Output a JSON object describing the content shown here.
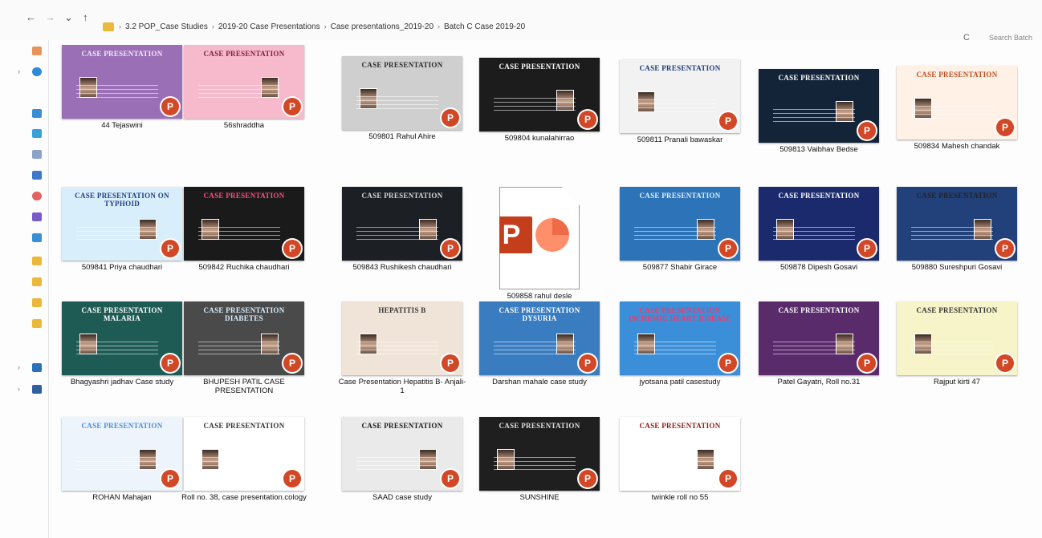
{
  "nav": {
    "back": "←",
    "forward": "→",
    "recent": "⌄",
    "up": "↑"
  },
  "breadcrumb": [
    "3.2 POP_Case Studies",
    "2019-20 Case Presentations",
    "Case presentations_2019-20",
    "Batch C Case 2019-20"
  ],
  "search_placeholder": "Search Batch",
  "refresh_glyph": "C",
  "files": [
    {
      "label": "44 Tejaswini",
      "title": "CASE PRESENTATION",
      "bg": "#9b6fb6",
      "fg": "#f4e9ff"
    },
    {
      "label": "56shraddha",
      "title": "CASE PRESENTATION",
      "bg": "#f7b9cc",
      "fg": "#7a1f3a"
    },
    {
      "label": "509801 Rahul Ahire",
      "title": "CASE PRESENTATION",
      "bg": "#cfcfcf",
      "fg": "#2b2b2b"
    },
    {
      "label": "509804 kunalahirrao",
      "title": "CASE PRESENTATION",
      "bg": "#1c1c1c",
      "fg": "#ffffff"
    },
    {
      "label": "509811 Pranali bawaskar",
      "title": "CASE PRESENTATION",
      "bg": "#f2f2f2",
      "fg": "#1b3b7a"
    },
    {
      "label": "509813 Vaibhav Bedse",
      "title": "CASE PRESENTATION",
      "bg": "#142438",
      "fg": "#ffffff"
    },
    {
      "label": "509834 Mahesh chandak",
      "title": "CASE PRESENTATION",
      "bg": "#fff1e6",
      "fg": "#c14a1f"
    },
    {
      "label": "509841 Priya chaudhari",
      "title": "Case presentation on Typhoid",
      "bg": "#d9eefb",
      "fg": "#1e3f82"
    },
    {
      "label": "509842 Ruchika chaudhari",
      "title": "CASE PRESENTATION",
      "bg": "#1a1a1a",
      "fg": "#ff4f7b"
    },
    {
      "label": "509843 Rushikesh chaudhari",
      "title": "Case presentation",
      "bg": "#1c1f24",
      "fg": "#d8d8d8"
    },
    {
      "label": "509858 rahul desle",
      "title": "",
      "bg": "#ffffff",
      "fg": "#000000"
    },
    {
      "label": "509877 Shabir Girace",
      "title": "CASE PRESENTATION",
      "bg": "#2d73b8",
      "fg": "#e3f1ff"
    },
    {
      "label": "509878 Dipesh Gosavi",
      "title": "CASE PRESENTATION",
      "bg": "#1a2a6c",
      "fg": "#ffffff"
    },
    {
      "label": "509880 Sureshpuri Gosavi",
      "title": "Case Presentation",
      "bg": "#22407a",
      "fg": "#222222"
    },
    {
      "label": "Bhagyashri jadhav Case study",
      "title": "Case Presentation MALARIA",
      "bg": "#1f5b55",
      "fg": "#ffffff"
    },
    {
      "label": "BHUPESH PATIL CASE PRESENTATION",
      "title": "CASE PRESENTATION DIABETES",
      "bg": "#4a4a4a",
      "fg": "#d9f0ff"
    },
    {
      "label": "Case Presentation Hepatitis B- Anjali-1",
      "title": "HEPATITIS B",
      "bg": "#f0e4d8",
      "fg": "#333333"
    },
    {
      "label": "Darshan mahale case study",
      "title": "Case Presentation DYSURIA",
      "bg": "#3a7cc0",
      "fg": "#ffffff"
    },
    {
      "label": "jyotsana patil casestudy",
      "title": "CASE PRESENTATION ISCHEMIC HEART DISEASE",
      "bg": "#3b8fd8",
      "fg": "#ff3366"
    },
    {
      "label": "Patel Gayatri, Roll no.31",
      "title": "CASE PRESENTATION",
      "bg": "#5a2b6b",
      "fg": "#ffffff"
    },
    {
      "label": "Rajput kirti 47",
      "title": "Case Presentation",
      "bg": "#f6f4c8",
      "fg": "#333333"
    },
    {
      "label": "ROHAN Mahajan",
      "title": "CASE PRESENTATION",
      "bg": "#eef4fb",
      "fg": "#4b8ed6"
    },
    {
      "label": "Roll no. 38, case presentation.cology",
      "title": "CASE PRESENTATION",
      "bg": "#ffffff",
      "fg": "#333333"
    },
    {
      "label": "SAAD case study",
      "title": "CASE PRESENTATION",
      "bg": "#eaeaea",
      "fg": "#1b1b1b"
    },
    {
      "label": "SUNSHINE",
      "title": "CASE PRESENTATION",
      "bg": "#1f1f1f",
      "fg": "#e0e0e0"
    },
    {
      "label": "twinkle roll no 55",
      "title": "CASE PRESENTATION",
      "bg": "#ffffff",
      "fg": "#8a1a1a"
    }
  ]
}
